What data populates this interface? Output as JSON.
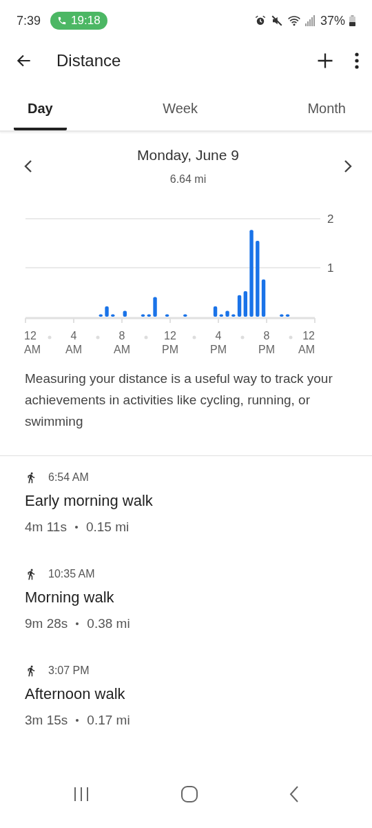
{
  "status_bar": {
    "time": "7:39",
    "call_timer": "19:18",
    "battery": "37%"
  },
  "app_bar": {
    "title": "Distance"
  },
  "tabs": [
    {
      "label": "Day",
      "selected": true
    },
    {
      "label": "Week",
      "selected": false
    },
    {
      "label": "Month",
      "selected": false
    }
  ],
  "date_nav": {
    "date": "Monday, June 9",
    "total": "6.64 mi"
  },
  "chart": {
    "chart_data": {
      "type": "bar",
      "categories": [
        "12 AM",
        null,
        null,
        null,
        null,
        null,
        null,
        null,
        "4 AM",
        null,
        null,
        null,
        null,
        null,
        null,
        null,
        "8 AM",
        null,
        null,
        null,
        null,
        null,
        null,
        null,
        "12 PM",
        null,
        null,
        null,
        null,
        null,
        null,
        null,
        "4 PM",
        null,
        null,
        null,
        null,
        null,
        null,
        null,
        "8 PM",
        null,
        null,
        null,
        null,
        null,
        null,
        null,
        "12 AM"
      ],
      "values": [
        0,
        0,
        0,
        0,
        0,
        0,
        0,
        0,
        0,
        0,
        0,
        0,
        0.05,
        0.21,
        0.05,
        0,
        0.12,
        0,
        0,
        0.05,
        0.05,
        0.4,
        0,
        0.05,
        0,
        0,
        0.05,
        0,
        0,
        0,
        0,
        0.21,
        0.05,
        0.12,
        0.05,
        0.44,
        0.52,
        1.77,
        1.55,
        0.76,
        0,
        0,
        0.05,
        0.05,
        0,
        0,
        0,
        0,
        0
      ],
      "ylim": [
        0,
        2
      ],
      "yticks": [
        1,
        2
      ]
    }
  },
  "description": "Measuring your distance is a useful way to track your achievements in activities like cycling, running, or swimming",
  "activities": [
    {
      "time": "6:54 AM",
      "title": "Early morning walk",
      "duration": "4m 11s",
      "distance": "0.15 mi"
    },
    {
      "time": "10:35 AM",
      "title": "Morning walk",
      "duration": "9m 28s",
      "distance": "0.38 mi"
    },
    {
      "time": "3:07 PM",
      "title": "Afternoon walk",
      "duration": "3m 15s",
      "distance": "0.17 mi"
    }
  ]
}
